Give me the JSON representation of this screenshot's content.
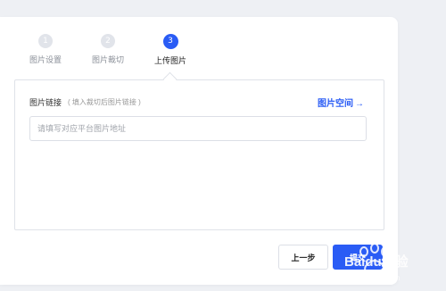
{
  "steps": [
    {
      "number": "1",
      "label": "图片设置"
    },
    {
      "number": "2",
      "label": "图片裁切"
    },
    {
      "number": "3",
      "label": "上传图片"
    }
  ],
  "form": {
    "label": "图片链接",
    "hint": "( 填入裁切后图片链接 )",
    "space_link": "图片空间",
    "space_arrow": "→",
    "input_placeholder": "请填写对应平台图片地址",
    "input_value": ""
  },
  "buttons": {
    "prev": "上一步",
    "submit": "提交"
  },
  "watermark": {
    "brand": "Baidu经验",
    "url": "jingyan.baidu.com"
  },
  "colors": {
    "accent": "#2a5cf5",
    "inactive_step": "#e1e4ea",
    "background": "#eef0f4"
  }
}
